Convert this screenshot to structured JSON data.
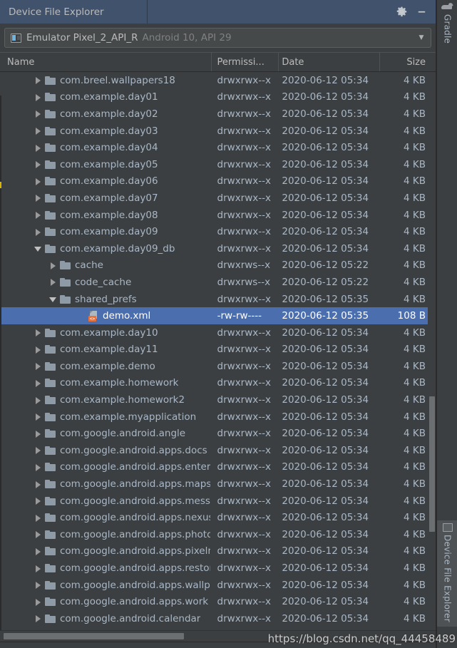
{
  "window": {
    "tool_window_title": "Device File Explorer",
    "settings_icon": "gear-icon",
    "minimize_icon": "minimize-icon"
  },
  "device_selector": {
    "device_name": "Emulator Pixel_2_API_R",
    "device_details": "Android 10, API 29",
    "device_icon": "android-device-icon",
    "dropdown_icon": "chevron-down-icon"
  },
  "table": {
    "columns": [
      {
        "key": "name",
        "label": "Name"
      },
      {
        "key": "permissions",
        "label": "Permissi..."
      },
      {
        "key": "date",
        "label": "Date"
      },
      {
        "key": "size",
        "label": "Size"
      }
    ],
    "rows": [
      {
        "name": "com.breel.wallpapers18",
        "permissions": "drwxrwx--x",
        "date": "2020-06-12 05:34",
        "size": "4 KB",
        "indent": 1,
        "type": "folder",
        "expanded": false,
        "selected": false
      },
      {
        "name": "com.example.day01",
        "permissions": "drwxrwx--x",
        "date": "2020-06-12 05:34",
        "size": "4 KB",
        "indent": 1,
        "type": "folder",
        "expanded": false,
        "selected": false
      },
      {
        "name": "com.example.day02",
        "permissions": "drwxrwx--x",
        "date": "2020-06-12 05:34",
        "size": "4 KB",
        "indent": 1,
        "type": "folder",
        "expanded": false,
        "selected": false
      },
      {
        "name": "com.example.day03",
        "permissions": "drwxrwx--x",
        "date": "2020-06-12 05:34",
        "size": "4 KB",
        "indent": 1,
        "type": "folder",
        "expanded": false,
        "selected": false
      },
      {
        "name": "com.example.day04",
        "permissions": "drwxrwx--x",
        "date": "2020-06-12 05:34",
        "size": "4 KB",
        "indent": 1,
        "type": "folder",
        "expanded": false,
        "selected": false
      },
      {
        "name": "com.example.day05",
        "permissions": "drwxrwx--x",
        "date": "2020-06-12 05:34",
        "size": "4 KB",
        "indent": 1,
        "type": "folder",
        "expanded": false,
        "selected": false
      },
      {
        "name": "com.example.day06",
        "permissions": "drwxrwx--x",
        "date": "2020-06-12 05:34",
        "size": "4 KB",
        "indent": 1,
        "type": "folder",
        "expanded": false,
        "selected": false
      },
      {
        "name": "com.example.day07",
        "permissions": "drwxrwx--x",
        "date": "2020-06-12 05:34",
        "size": "4 KB",
        "indent": 1,
        "type": "folder",
        "expanded": false,
        "selected": false
      },
      {
        "name": "com.example.day08",
        "permissions": "drwxrwx--x",
        "date": "2020-06-12 05:34",
        "size": "4 KB",
        "indent": 1,
        "type": "folder",
        "expanded": false,
        "selected": false
      },
      {
        "name": "com.example.day09",
        "permissions": "drwxrwx--x",
        "date": "2020-06-12 05:34",
        "size": "4 KB",
        "indent": 1,
        "type": "folder",
        "expanded": false,
        "selected": false
      },
      {
        "name": "com.example.day09_db",
        "permissions": "drwxrwx--x",
        "date": "2020-06-12 05:34",
        "size": "4 KB",
        "indent": 1,
        "type": "folder",
        "expanded": true,
        "selected": false
      },
      {
        "name": "cache",
        "permissions": "drwxrws--x",
        "date": "2020-06-12 05:22",
        "size": "4 KB",
        "indent": 2,
        "type": "folder",
        "expanded": false,
        "selected": false
      },
      {
        "name": "code_cache",
        "permissions": "drwxrws--x",
        "date": "2020-06-12 05:22",
        "size": "4 KB",
        "indent": 2,
        "type": "folder",
        "expanded": false,
        "selected": false
      },
      {
        "name": "shared_prefs",
        "permissions": "drwxrwx--x",
        "date": "2020-06-12 05:35",
        "size": "4 KB",
        "indent": 2,
        "type": "folder",
        "expanded": true,
        "selected": false
      },
      {
        "name": "demo.xml",
        "permissions": "-rw-rw----",
        "date": "2020-06-12 05:35",
        "size": "108 B",
        "indent": 3,
        "type": "xml",
        "expanded": false,
        "selected": true
      },
      {
        "name": "com.example.day10",
        "permissions": "drwxrwx--x",
        "date": "2020-06-12 05:34",
        "size": "4 KB",
        "indent": 1,
        "type": "folder",
        "expanded": false,
        "selected": false
      },
      {
        "name": "com.example.day11",
        "permissions": "drwxrwx--x",
        "date": "2020-06-12 05:34",
        "size": "4 KB",
        "indent": 1,
        "type": "folder",
        "expanded": false,
        "selected": false
      },
      {
        "name": "com.example.demo",
        "permissions": "drwxrwx--x",
        "date": "2020-06-12 05:34",
        "size": "4 KB",
        "indent": 1,
        "type": "folder",
        "expanded": false,
        "selected": false
      },
      {
        "name": "com.example.homework",
        "permissions": "drwxrwx--x",
        "date": "2020-06-12 05:34",
        "size": "4 KB",
        "indent": 1,
        "type": "folder",
        "expanded": false,
        "selected": false
      },
      {
        "name": "com.example.homework2",
        "permissions": "drwxrwx--x",
        "date": "2020-06-12 05:34",
        "size": "4 KB",
        "indent": 1,
        "type": "folder",
        "expanded": false,
        "selected": false
      },
      {
        "name": "com.example.myapplication",
        "permissions": "drwxrwx--x",
        "date": "2020-06-12 05:34",
        "size": "4 KB",
        "indent": 1,
        "type": "folder",
        "expanded": false,
        "selected": false
      },
      {
        "name": "com.google.android.angle",
        "permissions": "drwxrwx--x",
        "date": "2020-06-12 05:34",
        "size": "4 KB",
        "indent": 1,
        "type": "folder",
        "expanded": false,
        "selected": false
      },
      {
        "name": "com.google.android.apps.docs",
        "permissions": "drwxrwx--x",
        "date": "2020-06-12 05:34",
        "size": "4 KB",
        "indent": 1,
        "type": "folder",
        "expanded": false,
        "selected": false
      },
      {
        "name": "com.google.android.apps.enterprise",
        "permissions": "drwxrwx--x",
        "date": "2020-06-12 05:34",
        "size": "4 KB",
        "indent": 1,
        "type": "folder",
        "expanded": false,
        "selected": false
      },
      {
        "name": "com.google.android.apps.maps",
        "permissions": "drwxrwx--x",
        "date": "2020-06-12 05:34",
        "size": "4 KB",
        "indent": 1,
        "type": "folder",
        "expanded": false,
        "selected": false
      },
      {
        "name": "com.google.android.apps.messaging",
        "permissions": "drwxrwx--x",
        "date": "2020-06-12 05:34",
        "size": "4 KB",
        "indent": 1,
        "type": "folder",
        "expanded": false,
        "selected": false
      },
      {
        "name": "com.google.android.apps.nexuslauncher",
        "permissions": "drwxrwx--x",
        "date": "2020-06-12 05:34",
        "size": "4 KB",
        "indent": 1,
        "type": "folder",
        "expanded": false,
        "selected": false
      },
      {
        "name": "com.google.android.apps.photos",
        "permissions": "drwxrwx--x",
        "date": "2020-06-12 05:34",
        "size": "4 KB",
        "indent": 1,
        "type": "folder",
        "expanded": false,
        "selected": false
      },
      {
        "name": "com.google.android.apps.pixelmigrate",
        "permissions": "drwxrwx--x",
        "date": "2020-06-12 05:34",
        "size": "4 KB",
        "indent": 1,
        "type": "folder",
        "expanded": false,
        "selected": false
      },
      {
        "name": "com.google.android.apps.restore",
        "permissions": "drwxrwx--x",
        "date": "2020-06-12 05:34",
        "size": "4 KB",
        "indent": 1,
        "type": "folder",
        "expanded": false,
        "selected": false
      },
      {
        "name": "com.google.android.apps.wallpaper",
        "permissions": "drwxrwx--x",
        "date": "2020-06-12 05:34",
        "size": "4 KB",
        "indent": 1,
        "type": "folder",
        "expanded": false,
        "selected": false
      },
      {
        "name": "com.google.android.apps.work",
        "permissions": "drwxrwx--x",
        "date": "2020-06-12 05:34",
        "size": "4 KB",
        "indent": 1,
        "type": "folder",
        "expanded": false,
        "selected": false
      },
      {
        "name": "com.google.android.calendar",
        "permissions": "drwxrwx--x",
        "date": "2020-06-12 05:34",
        "size": "4 KB",
        "indent": 1,
        "type": "folder",
        "expanded": false,
        "selected": false
      }
    ]
  },
  "tool_strip": {
    "items": [
      {
        "label": "Gradle",
        "icon": "gradle-elephant-icon",
        "active": false
      },
      {
        "label": "Device File Explorer",
        "icon": "device-monitor-icon",
        "active": true
      }
    ]
  },
  "watermark": "https://blog.csdn.net/qq_44458489",
  "colors": {
    "selection": "#4b6eaf",
    "panel_bg": "#3c3f41",
    "header_tab_bg": "#41536c",
    "text": "#a9b7c6",
    "xml_badge": "#e8703a"
  }
}
